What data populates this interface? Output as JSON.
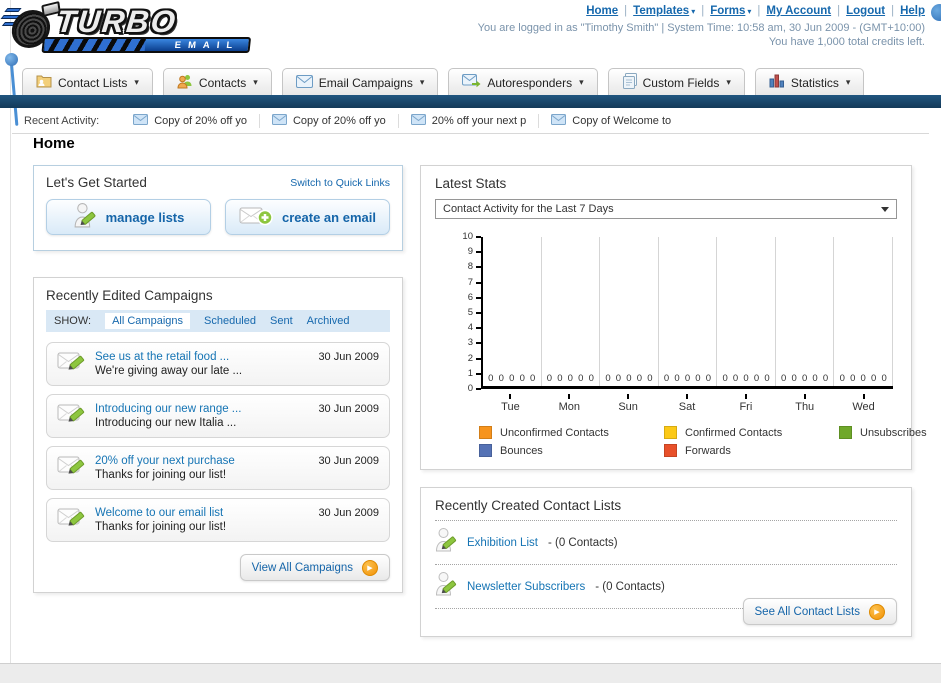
{
  "header": {
    "logo": {
      "line1": "TURBO",
      "line2": "EMAIL"
    },
    "links": [
      {
        "label": "Home",
        "dropdown": false
      },
      {
        "label": "Templates",
        "dropdown": true
      },
      {
        "label": "Forms",
        "dropdown": true
      },
      {
        "label": "My Account",
        "dropdown": false
      },
      {
        "label": "Logout",
        "dropdown": false
      },
      {
        "label": "Help",
        "dropdown": false
      }
    ],
    "login_line": "You are logged in as \"Timothy Smith\" | System Time: 10:58 am, 30 Jun 2009 - (GMT+10:00)",
    "credits_line": "You have 1,000 total credits left."
  },
  "nav": {
    "tabs": [
      {
        "label": "Contact Lists",
        "icon": "contact-lists-icon"
      },
      {
        "label": "Contacts",
        "icon": "contacts-icon"
      },
      {
        "label": "Email Campaigns",
        "icon": "email-campaigns-icon"
      },
      {
        "label": "Autoresponders",
        "icon": "autoresponders-icon"
      },
      {
        "label": "Custom Fields",
        "icon": "custom-fields-icon"
      },
      {
        "label": "Statistics",
        "icon": "statistics-icon"
      }
    ]
  },
  "recent_activity": {
    "label": "Recent Activity:",
    "items": [
      "Copy of 20% off yo",
      "Copy of 20% off yo",
      "20% off your next p",
      "Copy of Welcome to"
    ]
  },
  "page_title": "Home",
  "get_started": {
    "title": "Let's Get Started",
    "switch_link": "Switch to Quick Links",
    "buttons": [
      {
        "label": "manage lists",
        "icon": "person-pencil-icon"
      },
      {
        "label": "create an email",
        "icon": "envelope-plus-icon"
      }
    ]
  },
  "campaigns": {
    "title": "Recently Edited Campaigns",
    "show_label": "SHOW:",
    "filters": [
      {
        "label": "All Campaigns",
        "active": true
      },
      {
        "label": "Scheduled",
        "active": false
      },
      {
        "label": "Sent",
        "active": false
      },
      {
        "label": "Archived",
        "active": false
      }
    ],
    "rows": [
      {
        "title": "See us at the retail food ...",
        "subtitle": "We're giving away our late ...",
        "date": "30 Jun 2009"
      },
      {
        "title": "Introducing our new range ...",
        "subtitle": "Introducing our new Italia ...",
        "date": "30 Jun 2009"
      },
      {
        "title": "20% off your next purchase",
        "subtitle": "Thanks for joining our list!",
        "date": "30 Jun 2009"
      },
      {
        "title": "Welcome to our email list",
        "subtitle": "Thanks for joining our list!",
        "date": "30 Jun 2009"
      }
    ],
    "view_all_label": "View All Campaigns"
  },
  "latest_stats": {
    "title": "Latest Stats",
    "dropdown_value": "Contact Activity for the Last 7 Days"
  },
  "chart_data": {
    "type": "bar",
    "title": "Contact Activity for the Last 7 Days",
    "categories": [
      "Tue",
      "Mon",
      "Sun",
      "Sat",
      "Fri",
      "Thu",
      "Wed"
    ],
    "series": [
      {
        "name": "Unconfirmed Contacts",
        "color": "#f7941d",
        "values": [
          0,
          0,
          0,
          0,
          0,
          0,
          0
        ]
      },
      {
        "name": "Confirmed Contacts",
        "color": "#fcc917",
        "values": [
          0,
          0,
          0,
          0,
          0,
          0,
          0
        ]
      },
      {
        "name": "Unsubscribes",
        "color": "#6fa82a",
        "values": [
          0,
          0,
          0,
          0,
          0,
          0,
          0
        ]
      },
      {
        "name": "Bounces",
        "color": "#5572b5",
        "values": [
          0,
          0,
          0,
          0,
          0,
          0,
          0
        ]
      },
      {
        "name": "Forwards",
        "color": "#e8502a",
        "values": [
          0,
          0,
          0,
          0,
          0,
          0,
          0
        ]
      }
    ],
    "xlabel": "",
    "ylabel": "",
    "ylim": [
      0,
      10
    ],
    "yticks": [
      0,
      1,
      2,
      3,
      4,
      5,
      6,
      7,
      8,
      9,
      10
    ],
    "grid": "vertical",
    "legend_position": "bottom"
  },
  "contact_lists": {
    "title": "Recently Created Contact Lists",
    "items": [
      {
        "name": "Exhibition List",
        "detail": "- (0 Contacts)"
      },
      {
        "name": "Newsletter Subscribers",
        "detail": "- (0 Contacts)"
      }
    ],
    "see_all_label": "See All Contact Lists"
  },
  "colors": {
    "link_blue": "#1668ad",
    "navy_bar": "#1b4769",
    "panel_border": "#d2d2d2"
  }
}
